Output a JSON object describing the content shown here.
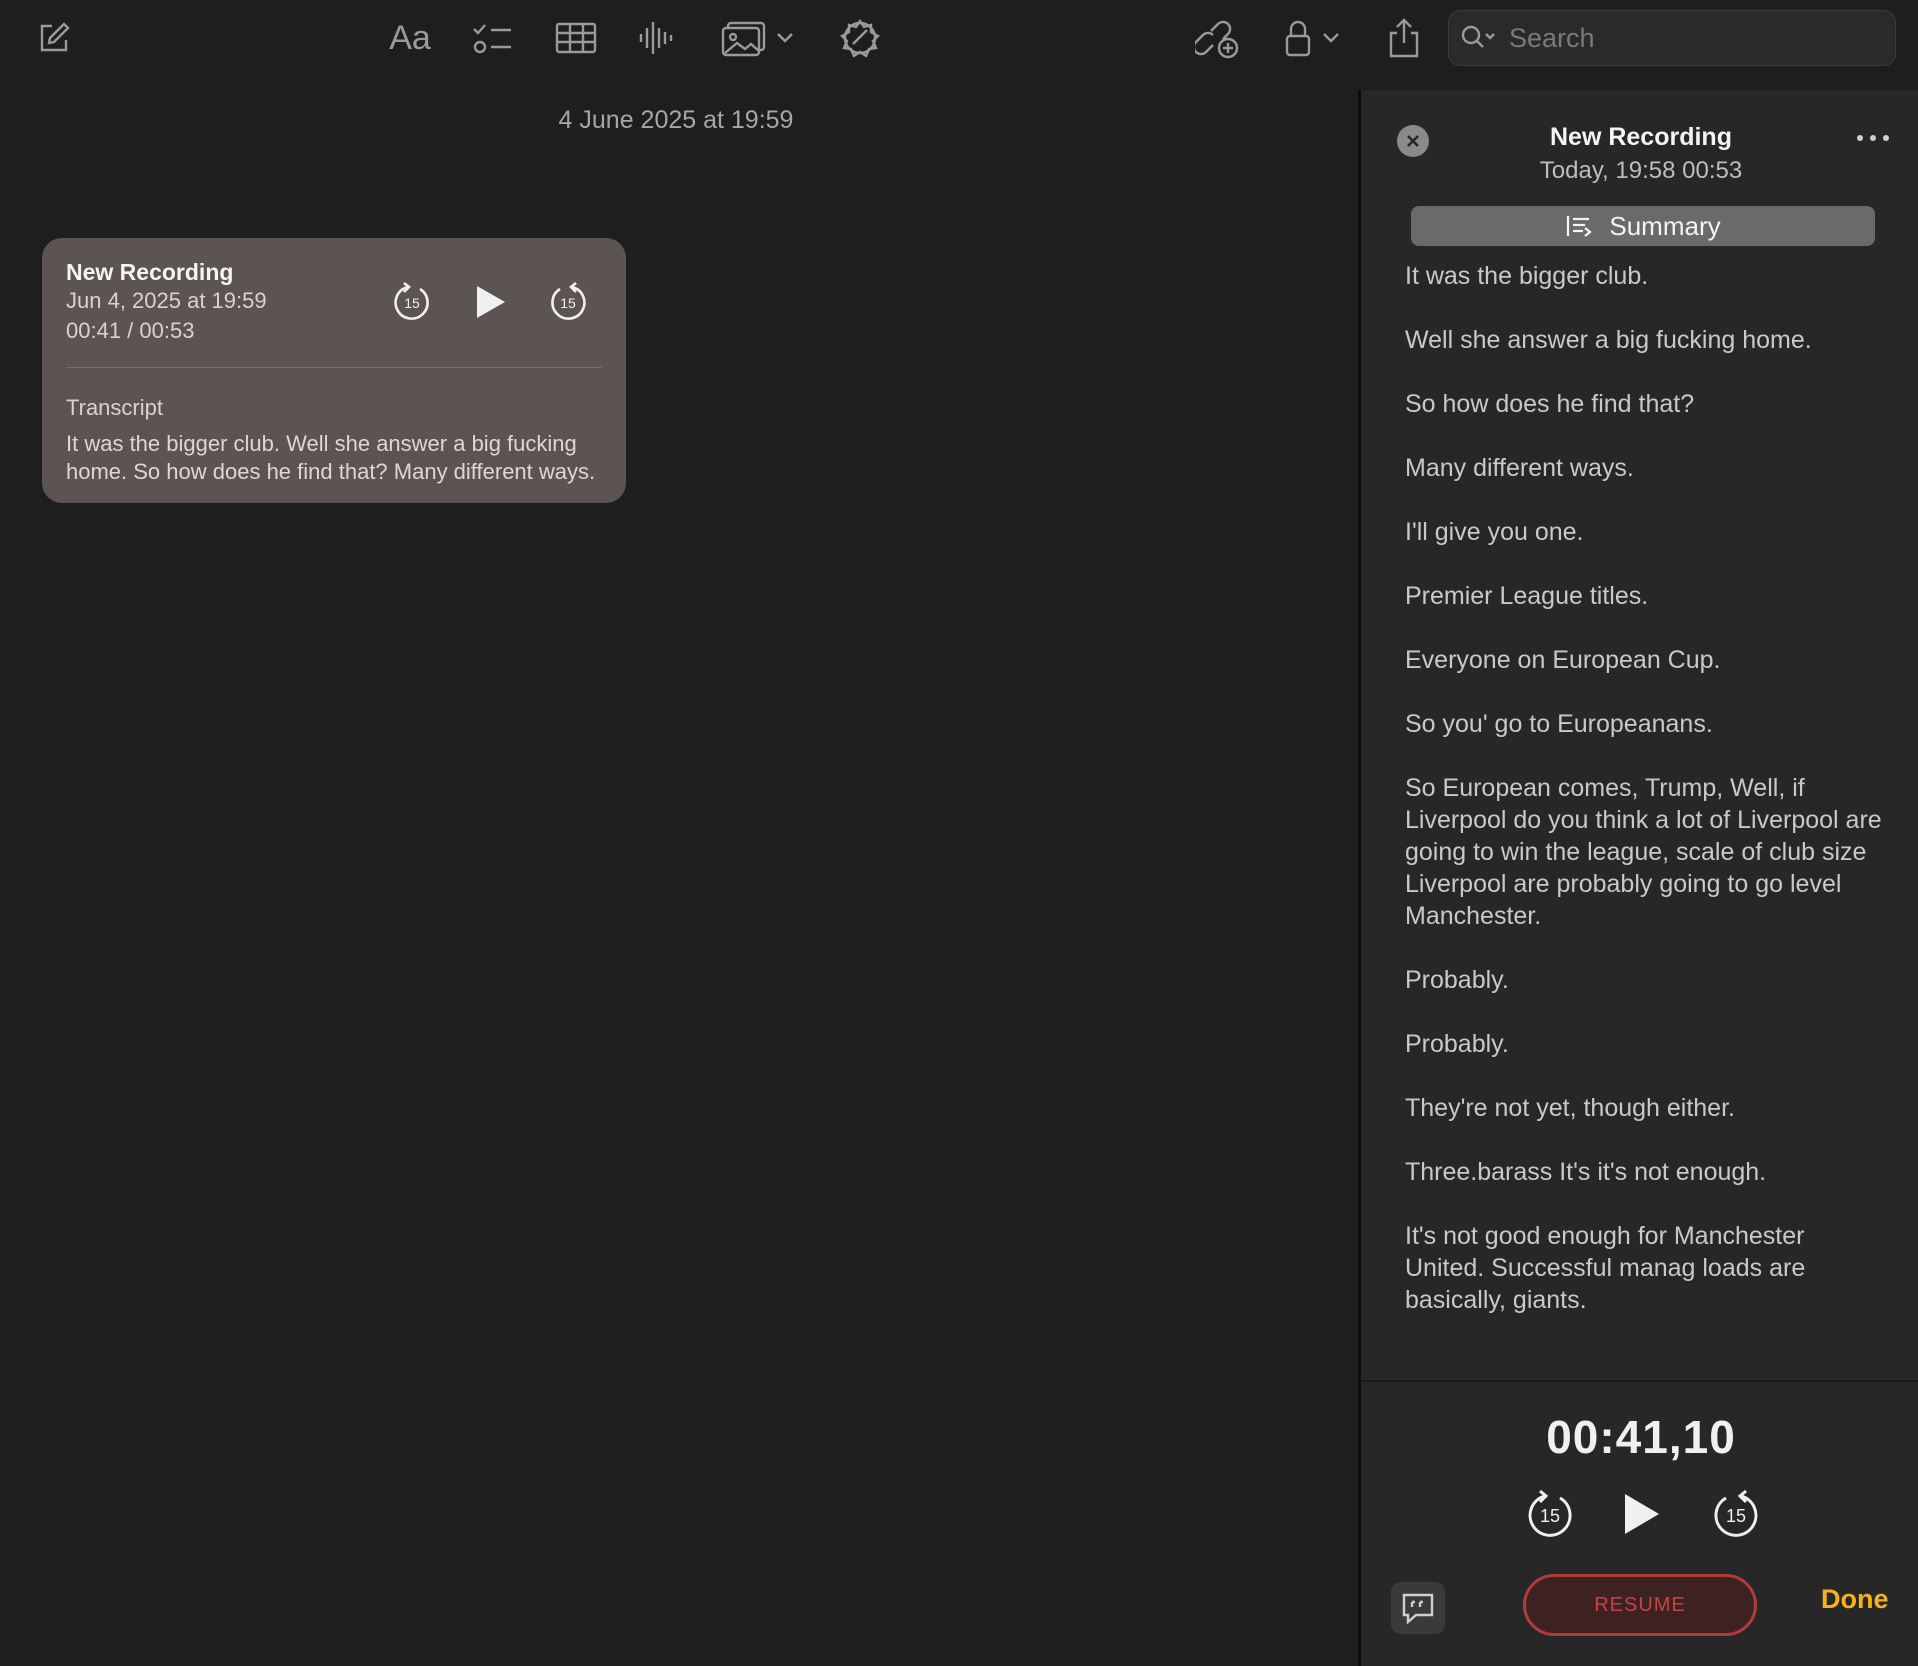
{
  "toolbar": {
    "format_label": "Aa",
    "search": {
      "placeholder": "Search",
      "value": ""
    }
  },
  "note": {
    "date": "4 June 2025 at 19:59"
  },
  "recording_card": {
    "title": "New Recording",
    "date": "Jun 4, 2025 at 19:59",
    "time": "00:41 / 00:53",
    "skip_back_label": "15",
    "skip_forward_label": "15",
    "transcript_label": "Transcript",
    "transcript_preview": "It was the bigger club. Well she answer a big fucking home. So how does he find that? Many different ways."
  },
  "panel": {
    "title": "New Recording",
    "subtitle": "Today, 19:58  00:53",
    "summary_label": "Summary",
    "transcript": [
      "It was the bigger club.",
      "Well she answer a big fucking home.",
      "So how does he find that?",
      "Many different ways.",
      "I'll give you one.",
      "Premier League titles.",
      "Everyone on European Cup.",
      "So you' go to Europeanans.",
      "So European comes, Trump, Well, if Liverpool do you think a lot of Liverpool are going to win the league, scale of club size Liverpool are probably going to go level Manchester.",
      "Probably.",
      "Probably.",
      "They're not yet, though either.",
      "Three.barass It's it's not enough.",
      "It's not good enough for Manchester United. Successful manag loads are basically, giants."
    ],
    "timer": "00:41,10",
    "skip_back_label": "15",
    "skip_forward_label": "15",
    "resume_label": "RESUME",
    "done_label": "Done"
  },
  "colors": {
    "background": "#1e1e1e",
    "card": "#5c5452",
    "panel": "#272727",
    "done_accent": "#f6b21a",
    "resume_accent": "#b23a3a"
  },
  "icons": [
    "compose-icon",
    "format-text-icon",
    "checklist-icon",
    "table-icon",
    "audio-waveform-icon",
    "media-icon",
    "chevron-down-icon",
    "math-icon",
    "collaborate-icon",
    "lock-icon",
    "share-icon",
    "search-icon",
    "close-icon",
    "more-icon",
    "summary-icon",
    "skip-back-15-icon",
    "play-icon",
    "skip-forward-15-icon",
    "transcript-bubble-icon"
  ]
}
